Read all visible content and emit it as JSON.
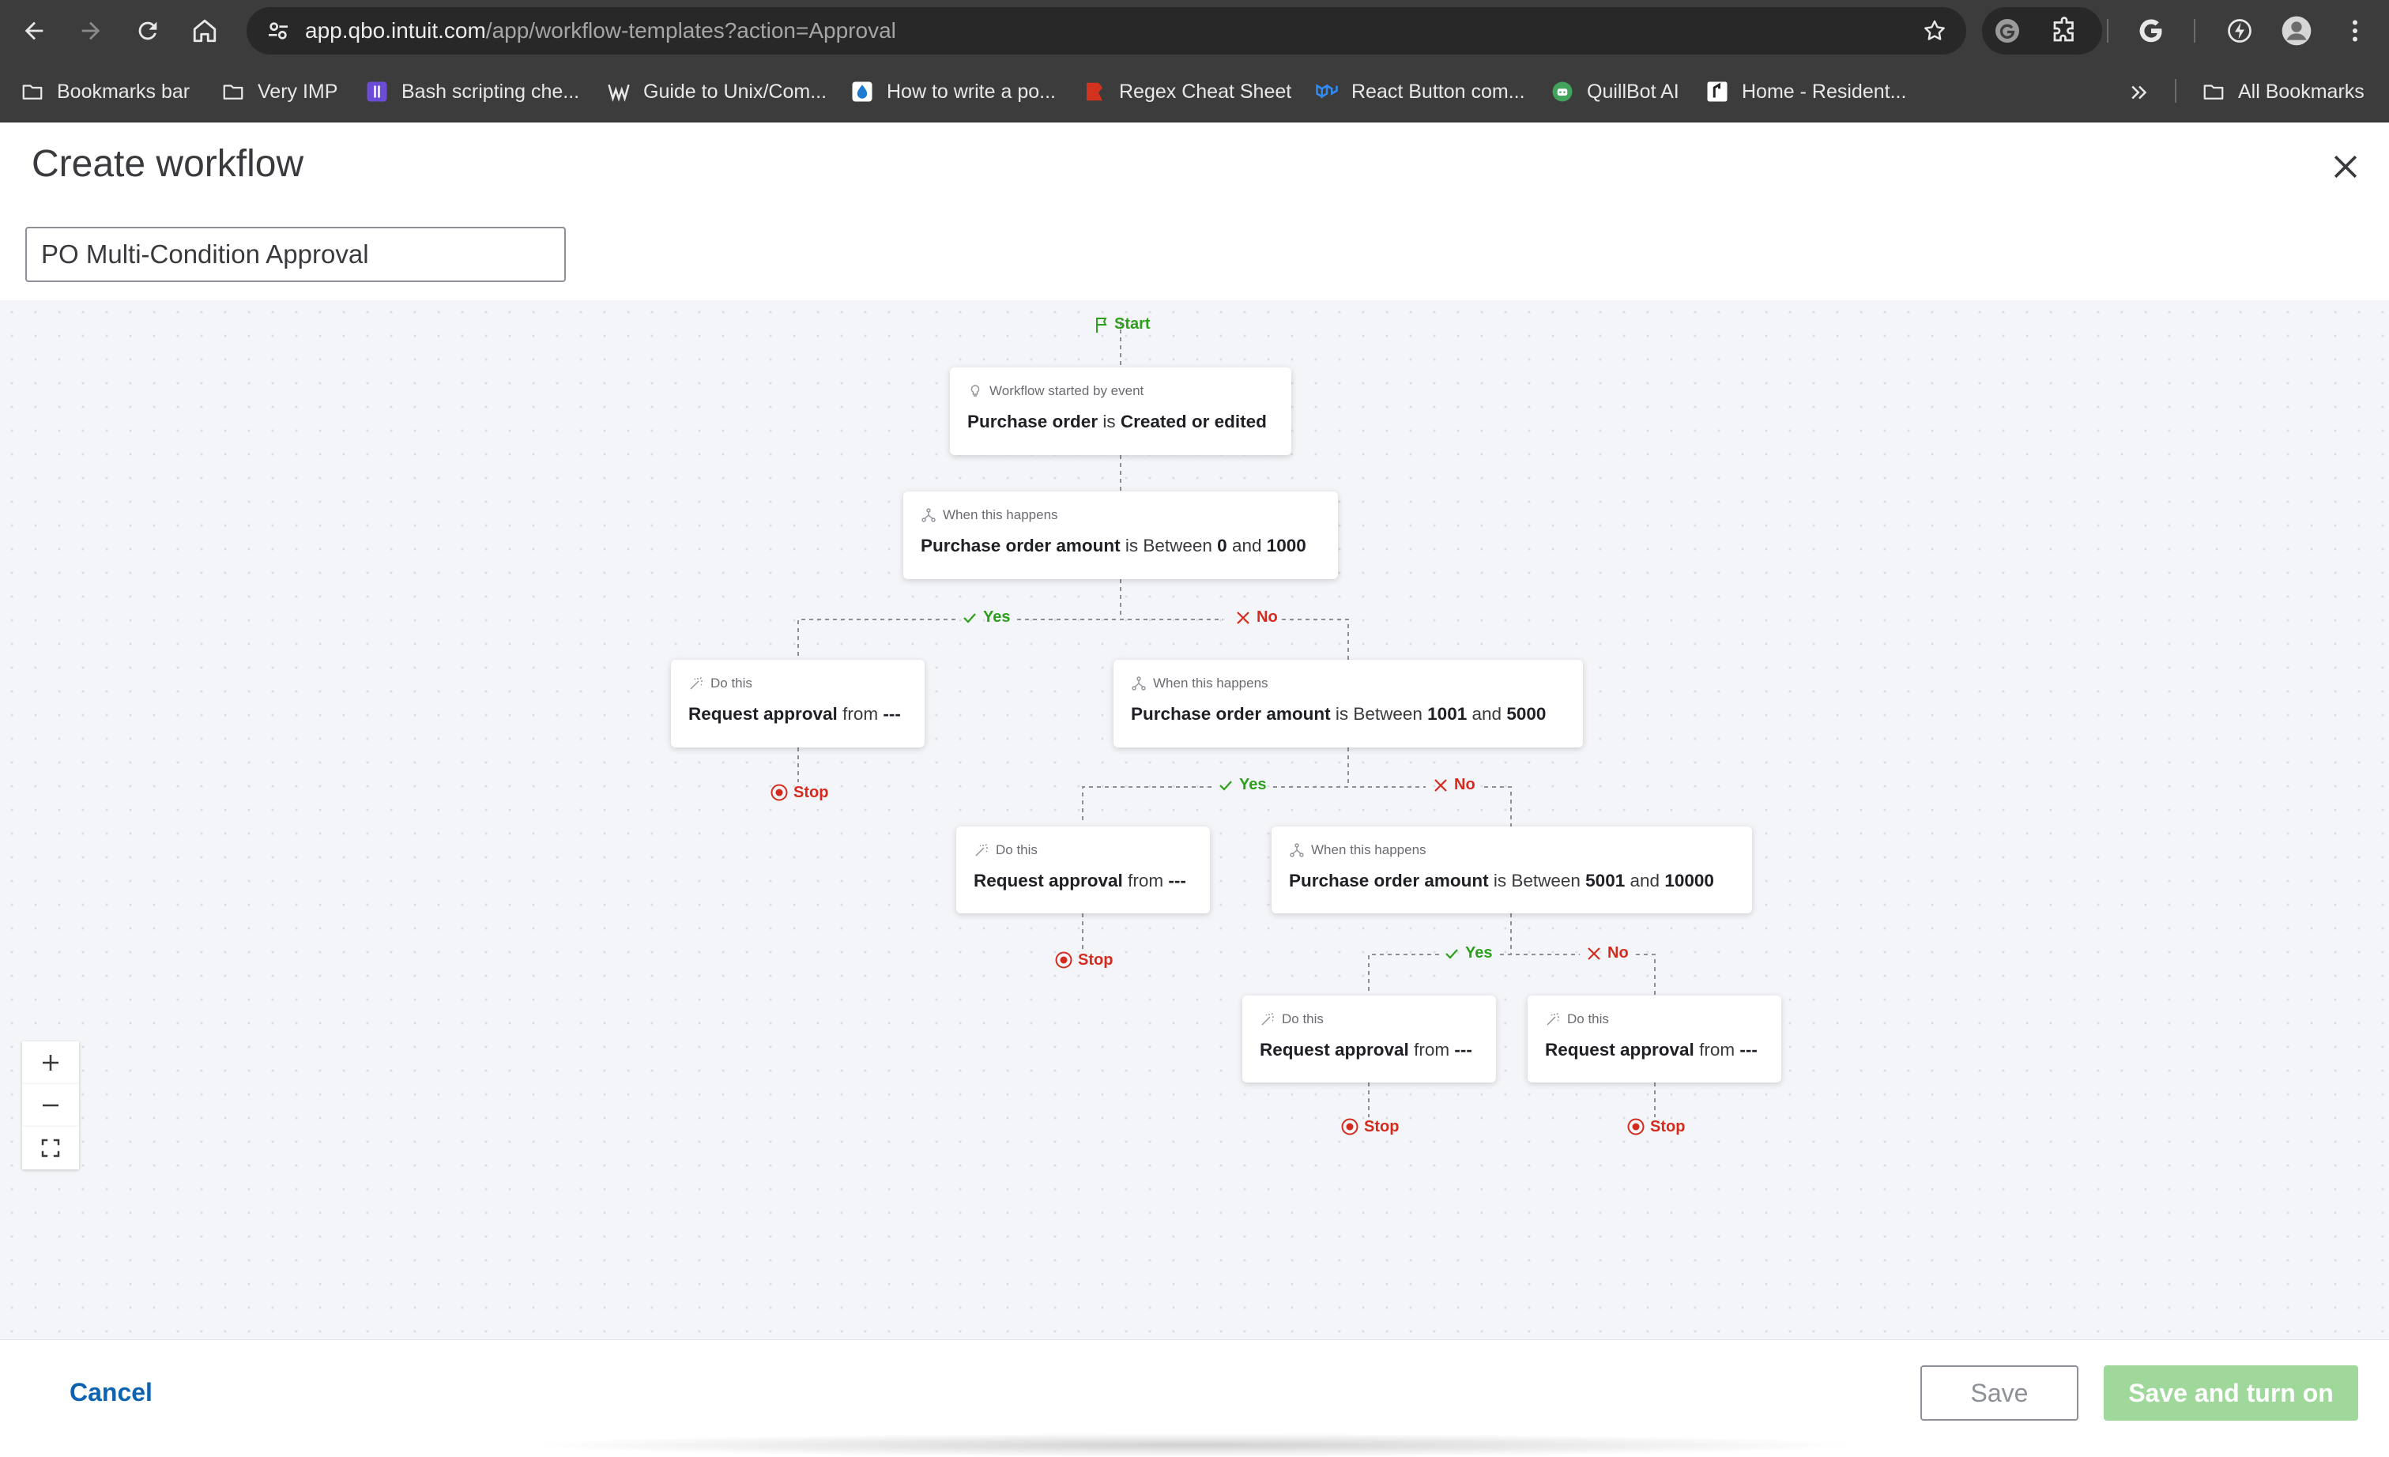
{
  "browser": {
    "url_host": "app.qbo.intuit.com",
    "url_path": "/app/workflow-templates?action=Approval",
    "bookmarks": [
      {
        "label": "Bookmarks bar",
        "icon": "folder-icon"
      },
      {
        "label": "Very IMP",
        "icon": "folder-icon"
      },
      {
        "label": "Bash scripting che...",
        "icon": "bash-favicon"
      },
      {
        "label": "Guide to Unix/Com...",
        "icon": "wordpress-favicon"
      },
      {
        "label": "How to write a po...",
        "icon": "drop-favicon"
      },
      {
        "label": "Regex Cheat Sheet",
        "icon": "regex-favicon"
      },
      {
        "label": "React Button com...",
        "icon": "mui-favicon"
      },
      {
        "label": "QuillBot AI",
        "icon": "quillbot-favicon"
      },
      {
        "label": "Home - Resident...",
        "icon": "resident-favicon"
      }
    ],
    "all_bookmarks": "All Bookmarks"
  },
  "page": {
    "title": "Create workflow",
    "workflow_name": "PO Multi-Condition Approval"
  },
  "flow": {
    "start_label": "Start",
    "trigger": {
      "caption": "Workflow started by event",
      "subject": "Purchase order",
      "verb": "is",
      "event": "Created or edited"
    },
    "conditions": [
      {
        "caption": "When this happens",
        "field": "Purchase order amount",
        "op": "is Between",
        "low": "0",
        "and": "and",
        "high": "1000"
      },
      {
        "caption": "When this happens",
        "field": "Purchase order amount",
        "op": "is Between",
        "low": "1001",
        "and": "and",
        "high": "5000"
      },
      {
        "caption": "When this happens",
        "field": "Purchase order amount",
        "op": "is Between",
        "low": "5001",
        "and": "and",
        "high": "10000"
      }
    ],
    "actions": [
      {
        "caption": "Do this",
        "action": "Request approval",
        "from": "from",
        "value": "---"
      },
      {
        "caption": "Do this",
        "action": "Request approval",
        "from": "from",
        "value": "---"
      },
      {
        "caption": "Do this",
        "action": "Request approval",
        "from": "from",
        "value": "---"
      },
      {
        "caption": "Do this",
        "action": "Request approval",
        "from": "from",
        "value": "---"
      }
    ],
    "yes_label": "Yes",
    "no_label": "No",
    "stop_label": "Stop"
  },
  "footer": {
    "cancel": "Cancel",
    "save": "Save",
    "save_and_turn_on": "Save and turn on"
  },
  "colors": {
    "accent_green": "#2ca01c",
    "stop_red": "#d52b1e",
    "link_blue": "#0d63b0",
    "disabled_green": "#9fd89a"
  }
}
